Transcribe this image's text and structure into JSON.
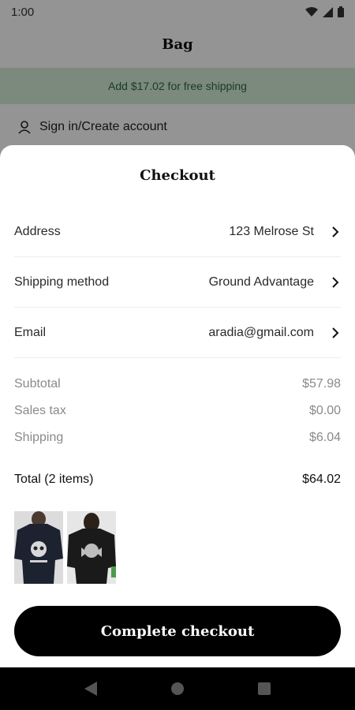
{
  "status_bar": {
    "time": "1:00"
  },
  "background_screen": {
    "title": "Bag",
    "free_shipping_banner": "Add $17.02 for free shipping",
    "signin_label": "Sign in/Create account"
  },
  "checkout": {
    "title": "Checkout",
    "rows": [
      {
        "label": "Address",
        "value": "123 Melrose St"
      },
      {
        "label": "Shipping method",
        "value": "Ground Advantage"
      },
      {
        "label": "Email",
        "value": "aradia@gmail.com"
      }
    ],
    "costs": [
      {
        "label": "Subtotal",
        "value": "$57.98"
      },
      {
        "label": "Sales tax",
        "value": "$0.00"
      },
      {
        "label": "Shipping",
        "value": "$6.04"
      }
    ],
    "total": {
      "label": "Total (2 items)",
      "value": "$64.02"
    },
    "items": [
      {
        "icon": "black-tshirt-skull-print"
      },
      {
        "icon": "black-tshirt-angel-print"
      }
    ],
    "cta_label": "Complete checkout"
  },
  "nav": {
    "icons": [
      "back-icon",
      "home-icon",
      "recents-icon"
    ]
  }
}
